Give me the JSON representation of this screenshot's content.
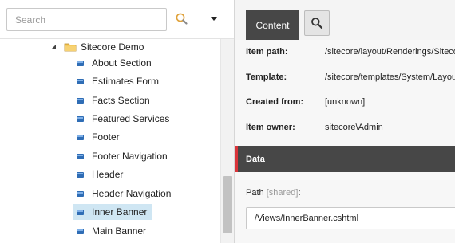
{
  "search": {
    "placeholder": "Search",
    "value": ""
  },
  "tree": {
    "root": {
      "label": "Sitecore Demo",
      "expanded": true
    },
    "items": [
      {
        "label": "About Section",
        "selected": false
      },
      {
        "label": "Estimates Form",
        "selected": false
      },
      {
        "label": "Facts Section",
        "selected": false
      },
      {
        "label": "Featured Services",
        "selected": false
      },
      {
        "label": "Footer",
        "selected": false
      },
      {
        "label": "Footer Navigation",
        "selected": false
      },
      {
        "label": "Header",
        "selected": false
      },
      {
        "label": "Header Navigation",
        "selected": false
      },
      {
        "label": "Inner Banner",
        "selected": true
      },
      {
        "label": "Main Banner",
        "selected": false
      }
    ]
  },
  "editor": {
    "tabs": {
      "content": "Content"
    },
    "info": {
      "item_path_label": "Item path:",
      "item_path_value": "/sitecore/layout/Renderings/Sitecore Demo/Inner Banner",
      "template_label": "Template:",
      "template_value": "/sitecore/templates/System/Layout/Renderings/View rendering",
      "created_from_label": "Created from:",
      "created_from_value": "[unknown]",
      "item_owner_label": "Item owner:",
      "item_owner_value": "sitecore\\Admin"
    },
    "section": {
      "title": "Data"
    },
    "field": {
      "label": "Path",
      "shared": "[shared]",
      "suffix": ":",
      "value": "/Views/InnerBanner.cshtml"
    }
  },
  "colors": {
    "accent_red": "#d9343a",
    "dark_header": "#474747",
    "selected_row": "#cfe6f3",
    "item_icon_blue": "#2f6db5"
  },
  "icons": {
    "search": "magnifier-icon",
    "dropdown": "caret-down-icon",
    "expander": "triangle-expanded-icon",
    "folder": "folder-icon",
    "rendering": "rendering-item-icon"
  }
}
